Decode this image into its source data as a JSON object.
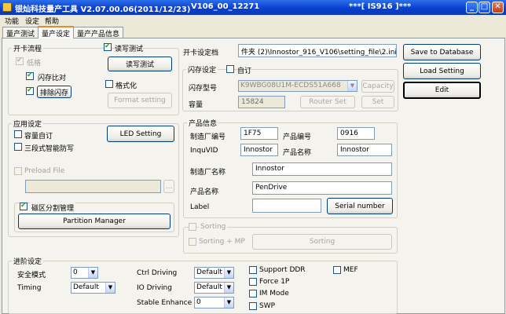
{
  "window": {
    "title": "银灿科技量产工具 V2.07.00.06(2011/12/23)",
    "version": "V106_00_12271",
    "ic": "***[ IS916 ]***",
    "btn_min": "_",
    "btn_max": "□",
    "btn_close": "✕"
  },
  "menu": [
    "功能",
    "设定",
    "帮助"
  ],
  "tabs": [
    "量产测试",
    "量产设定",
    "量产产品信息"
  ],
  "card_flow": {
    "legend": "开卡流程",
    "low_format": "低格",
    "flash_compare": "闪存比对",
    "remove_flash": "排除闪存",
    "rw_test_chk": "读写测试",
    "rw_test_btn": "读写测试",
    "format_chk": "格式化",
    "format_btn": "Format setting"
  },
  "card_file": {
    "label": "开卡设定档",
    "path": "件夹 (2)\\Innostor_916_V106\\setting_file\\2.ini"
  },
  "flash": {
    "legend": "闪存设定",
    "custom": "自订",
    "model_label": "闪存型号",
    "model_value": "K9WBG08U1M-ECDS51A668",
    "capacity_btn": "Capacity",
    "cap_label": "容量",
    "cap_value": "15824",
    "router_btn": "Router Set",
    "set_btn": "Set"
  },
  "actions": {
    "save": "Save to Database",
    "load": "Load Setting",
    "edit": "Edit"
  },
  "app": {
    "legend": "应用设定",
    "capacity_custom": "容量自订",
    "three_stage": "三段式智能防写",
    "led_btn": "LED Setting",
    "preload_label": "Preload File",
    "partition_chk": "磁区分割管理",
    "partition_btn": "Partition Manager"
  },
  "product": {
    "legend": "产品信息",
    "vendor_code_label": "制造厂编号",
    "vendor_code": "1F75",
    "product_code_label": "产品编号",
    "product_code": "0916",
    "inquvid_label": "InquVID",
    "inquvid": "Innostor",
    "product_name_label": "产品名称",
    "product_name_short": "Innostor",
    "maker_label": "制造厂名称",
    "maker": "Innostor",
    "pname_label": "产品名称",
    "pname": "PenDrive",
    "label_label": "Label",
    "label_value": "",
    "serial_btn": "Serial number"
  },
  "sorting": {
    "sorting": "Sorting",
    "sorting_mp": "Sorting + MP",
    "sorting_btn": "Sorting"
  },
  "advanced": {
    "legend": "进阶设定",
    "safe_mode_label": "安全模式",
    "safe_mode": "0",
    "timing_label": "Timing",
    "timing": "Default",
    "ctrl_label": "Ctrl Driving",
    "ctrl": "Default",
    "io_label": "IO Driving",
    "io": "Default",
    "stable_label": "Stable Enhance",
    "stable": "0",
    "support_ddr": "Support DDR",
    "force1p": "Force 1P",
    "im_mode": "IM Mode",
    "swp": "SWP",
    "mef": "MEF"
  }
}
